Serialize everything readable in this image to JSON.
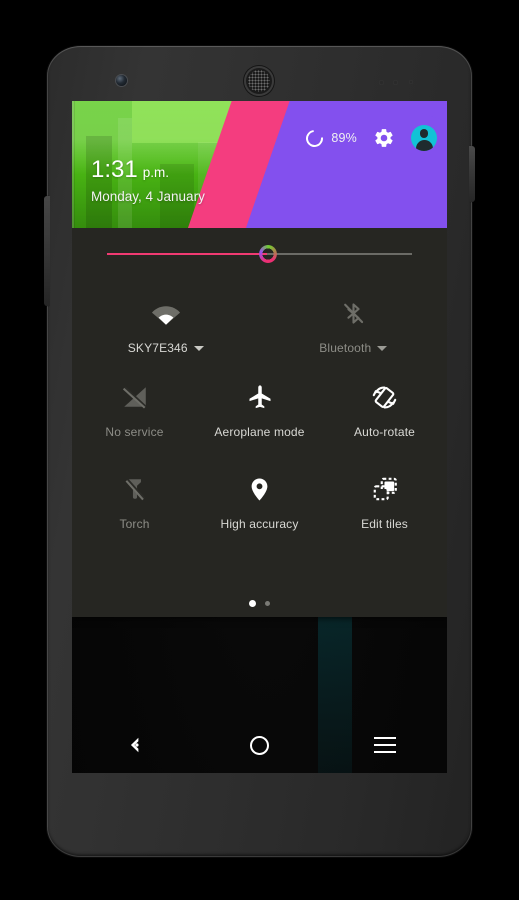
{
  "device": {
    "name": "android-phone",
    "orientation": "portrait"
  },
  "quick_settings": {
    "header": {
      "time": "1:31",
      "ampm": "p.m.",
      "date": "Monday, 4 January",
      "battery_percent": "89%",
      "battery_icon": "battery-ring-icon",
      "settings_icon": "gear-icon",
      "user_icon": "avatar-icon",
      "colors": {
        "green": "#4fc015",
        "pink": "#f43d7f",
        "purple": "#8350ee",
        "avatar": "#12c2d6"
      }
    },
    "brightness": {
      "label": "brightness-slider",
      "value": "52",
      "fill_color": "#f03a72",
      "track_color": "#6b6b66"
    },
    "connectivity_tiles": [
      {
        "label": "SKY7E346",
        "icon": "wifi-icon",
        "state": "on",
        "has_caret": true
      },
      {
        "label": "Bluetooth",
        "icon": "bluetooth-off-icon",
        "state": "off",
        "has_caret": true
      }
    ],
    "tiles": [
      {
        "label": "No service",
        "icon": "signal-off-icon",
        "state": "off"
      },
      {
        "label": "Aeroplane mode",
        "icon": "airplane-icon",
        "state": "on"
      },
      {
        "label": "Auto-rotate",
        "icon": "auto-rotate-icon",
        "state": "on"
      },
      {
        "label": "Torch",
        "icon": "torch-off-icon",
        "state": "off"
      },
      {
        "label": "High accuracy",
        "icon": "location-pin-icon",
        "state": "on"
      },
      {
        "label": "Edit tiles",
        "icon": "edit-tiles-icon",
        "state": "on"
      }
    ],
    "pager": {
      "pages": 2,
      "active_index": 0
    },
    "panel_color": "#262622"
  },
  "navbar": {
    "back": "back-icon",
    "home": "home-icon",
    "recents": "menu-icon"
  }
}
